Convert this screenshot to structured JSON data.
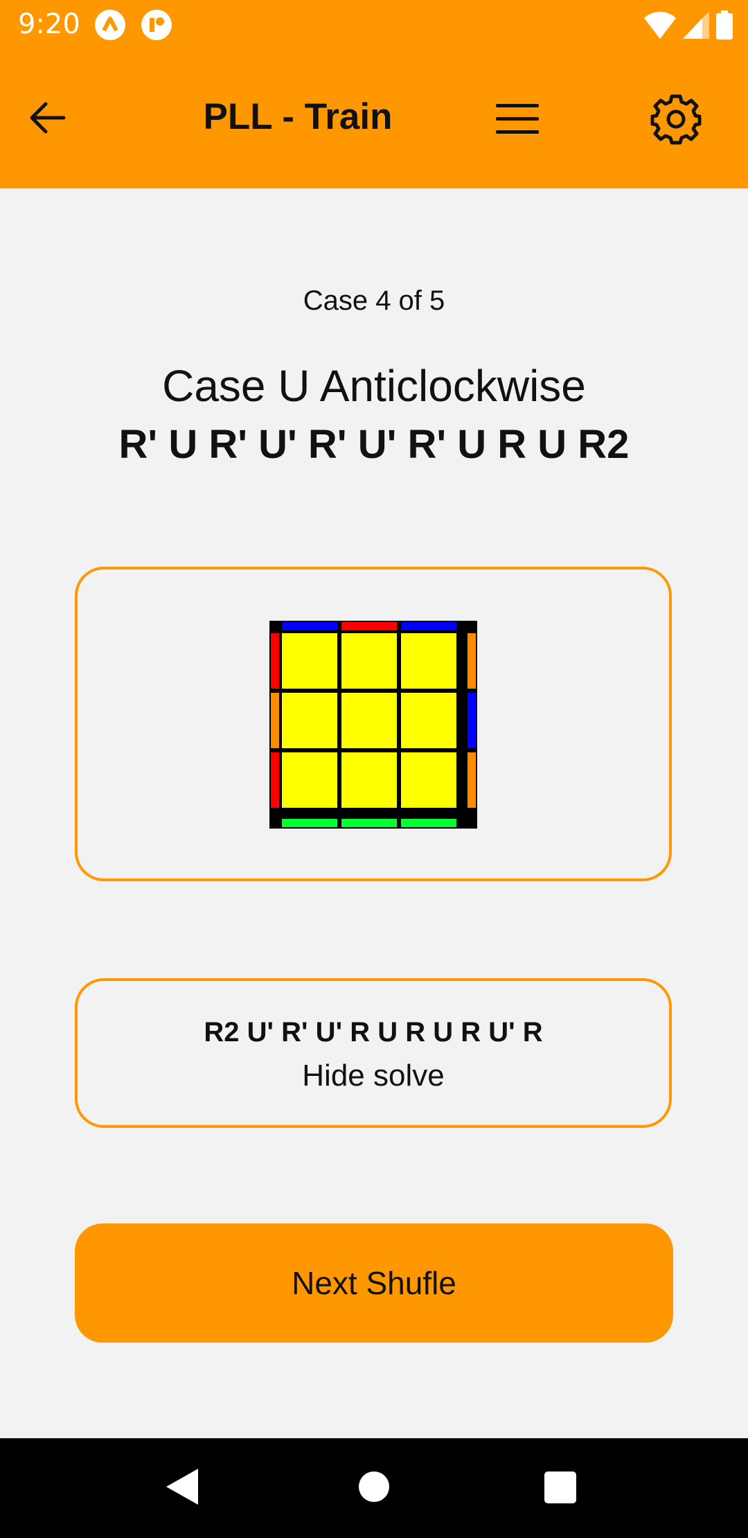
{
  "status_bar": {
    "time": "9:20",
    "icons": [
      "app-a-icon",
      "app-r-icon",
      "wifi-icon",
      "cellular-signal-icon",
      "battery-icon"
    ]
  },
  "app_bar": {
    "title": "PLL - Train",
    "back_icon": "arrow-left-icon",
    "menu_icon": "hamburger-menu-icon",
    "settings_icon": "gear-icon",
    "color": "#ff9800"
  },
  "case": {
    "counter": "Case 4 of 5",
    "name": "Case U Anticlockwise",
    "algorithm": "R' U R' U' R' U' R' U R U R2"
  },
  "cube": {
    "top_face": [
      [
        "yellow",
        "yellow",
        "yellow"
      ],
      [
        "yellow",
        "yellow",
        "yellow"
      ],
      [
        "yellow",
        "yellow",
        "yellow"
      ]
    ],
    "back_edge": [
      "blue",
      "red",
      "blue"
    ],
    "left_edge": [
      "red",
      "orange",
      "red"
    ],
    "right_edge": [
      "orange",
      "blue",
      "orange"
    ],
    "front_edge": [
      "green",
      "green",
      "green"
    ],
    "palette": {
      "yellow": "#ffff00",
      "blue": "#0000ff",
      "red": "#ff0000",
      "orange": "#ff8c00",
      "green": "#00ff33",
      "border": "#000000"
    }
  },
  "solve": {
    "algorithm": "R2 U' R' U' R U R U R U' R",
    "toggle_label": "Hide solve"
  },
  "next_button": {
    "label": "Next Shufle"
  },
  "nav_bar": {
    "icons": [
      "nav-back-icon",
      "nav-home-icon",
      "nav-recents-icon"
    ]
  }
}
